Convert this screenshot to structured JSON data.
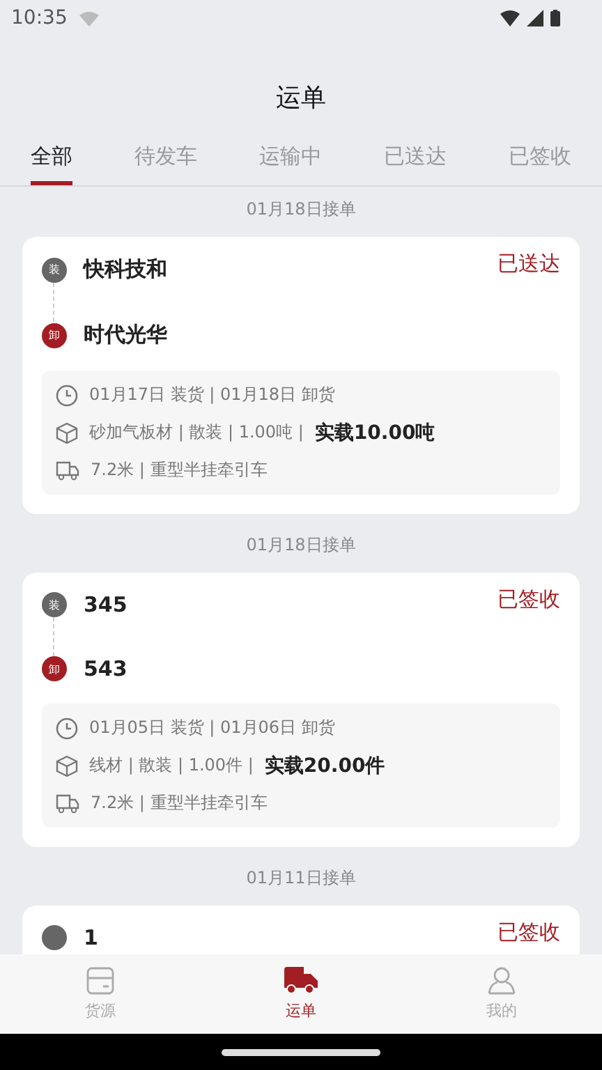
{
  "status_bar": {
    "time": "10:35"
  },
  "title": "运单",
  "tabs": [
    {
      "label": "全部",
      "selected": true
    },
    {
      "label": "待发车",
      "selected": false
    },
    {
      "label": "运输中",
      "selected": false
    },
    {
      "label": "已送达",
      "selected": false
    },
    {
      "label": "已签收",
      "selected": false
    }
  ],
  "orders": [
    {
      "date": "01月18日接单",
      "load_mark": "装",
      "origin": "快科技和",
      "unload_mark": "卸",
      "destination": "时代光华",
      "status": "已送达",
      "schedule": "01月17日 装货 | 01月18日 卸货",
      "cargo": "砂加气板材 | 散装 | 1.00吨 |",
      "actual": "实载10.00吨",
      "vehicle": "7.2米 | 重型半挂牵引车"
    },
    {
      "date": "01月18日接单",
      "load_mark": "装",
      "origin": "345",
      "unload_mark": "卸",
      "destination": "543",
      "status": "已签收",
      "schedule": "01月05日 装货 | 01月06日 卸货",
      "cargo": "线材 | 散装 | 1.00件 |",
      "actual": "实载20.00件",
      "vehicle": "7.2米 | 重型半挂牵引车"
    },
    {
      "date": "01月11日接单",
      "origin": "1",
      "status": "已签收"
    }
  ],
  "nav": [
    {
      "label": "货源",
      "selected": false,
      "kind": "box"
    },
    {
      "label": "运单",
      "selected": true,
      "kind": "truck"
    },
    {
      "label": "我的",
      "selected": false,
      "kind": "person"
    }
  ]
}
